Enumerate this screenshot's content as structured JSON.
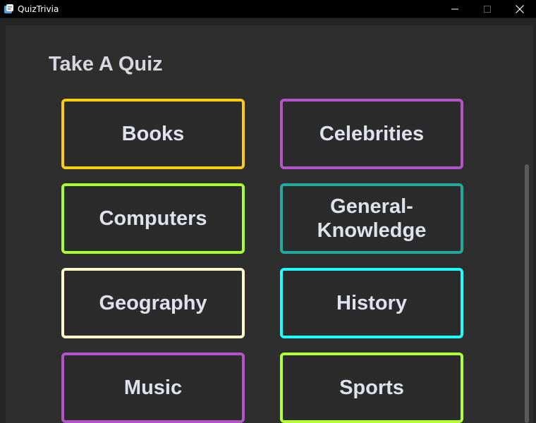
{
  "window": {
    "title": "QuizTrivia",
    "icon": "quiz-app-icon"
  },
  "heading": "Take A Quiz",
  "categories": [
    {
      "label": "Books",
      "color": "#f9cd11"
    },
    {
      "label": "Celebrities",
      "color": "#b553c9"
    },
    {
      "label": "Computers",
      "color": "#a5ff32"
    },
    {
      "label": "General-\nKnowledge",
      "color": "#23a9a0"
    },
    {
      "label": "Geography",
      "color": "#fff8c9"
    },
    {
      "label": "History",
      "color": "#1fffff"
    },
    {
      "label": "Music",
      "color": "#b553c9"
    },
    {
      "label": "Sports",
      "color": "#b0ff3a"
    }
  ],
  "window_controls": [
    "minimize-icon",
    "maximize-icon",
    "close-icon"
  ],
  "colors": {
    "background": "#2e2e2e",
    "titlebar": "#000000",
    "text": "#dfe2ec"
  }
}
